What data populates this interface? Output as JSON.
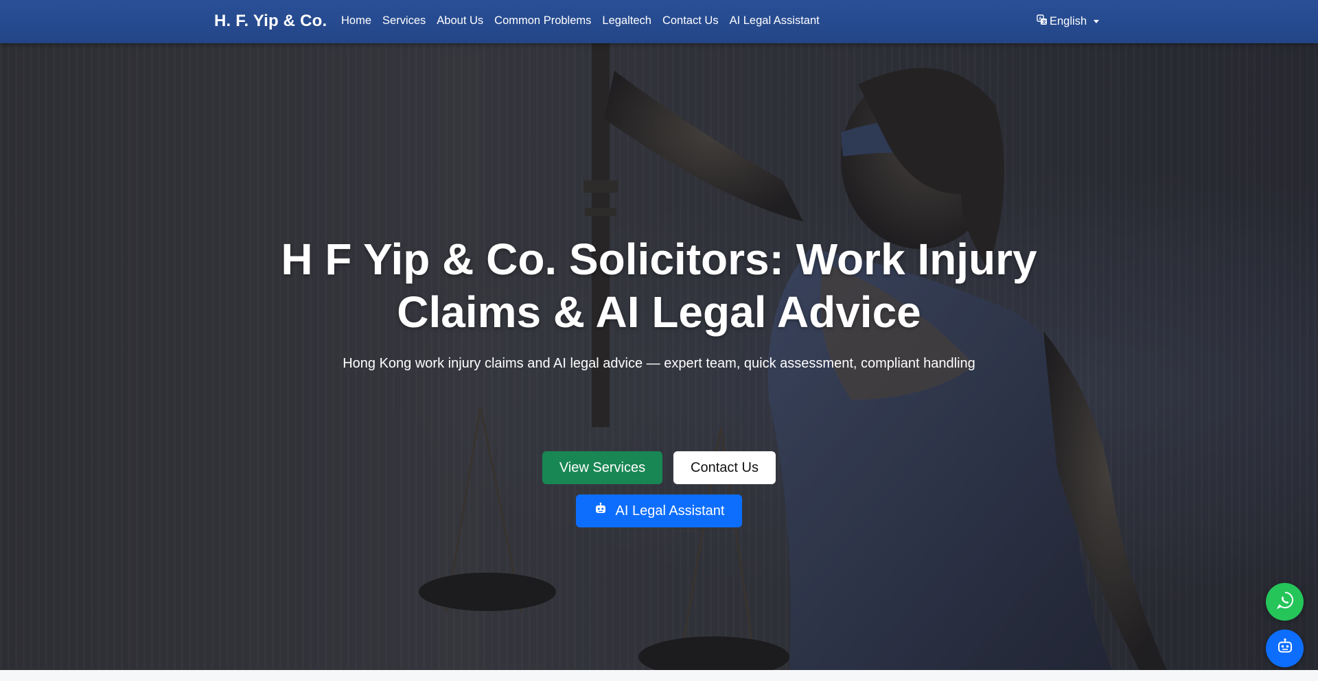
{
  "navbar": {
    "brand": "H. F. Yip & Co.",
    "links": [
      "Home",
      "Services",
      "About Us",
      "Common Problems",
      "Legaltech",
      "Contact Us",
      "AI Legal Assistant"
    ],
    "language": "English",
    "language_icon": "translate-icon"
  },
  "hero": {
    "title": "H F Yip & Co. Solicitors: Work Injury Claims & AI Legal Advice",
    "subtitle": "Hong Kong work injury claims and AI legal advice — expert team, quick assessment, compliant handling",
    "buttons": {
      "services": "View Services",
      "contact": "Contact Us",
      "ai": "AI Legal Assistant"
    }
  },
  "floating": {
    "whatsapp_icon": "whatsapp-icon",
    "bot_icon": "robot-icon"
  },
  "colors": {
    "navbar": "#2a4f97",
    "services_button": "#198754",
    "ai_button": "#0d6efd",
    "whatsapp": "#25c55a"
  }
}
